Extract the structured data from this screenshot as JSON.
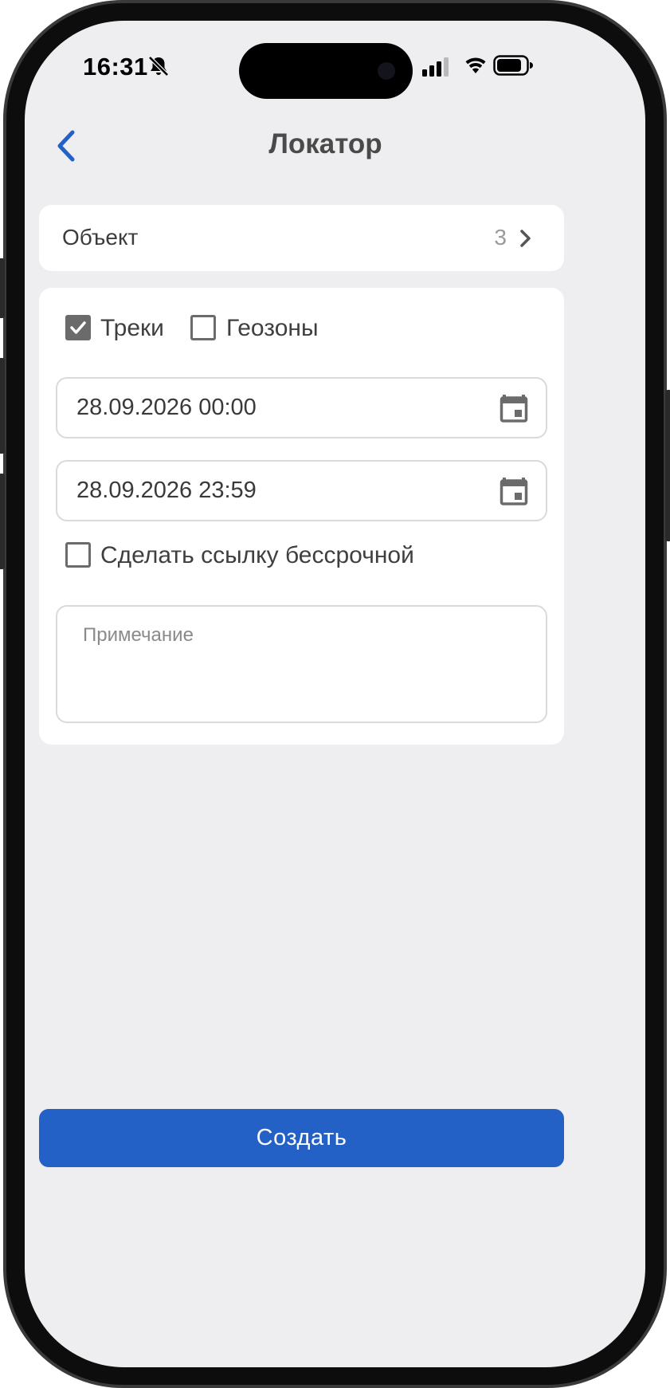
{
  "status_bar": {
    "time": "16:31",
    "silent_icon": "bell-slash-icon",
    "signal_icon": "cellular-signal-icon",
    "wifi_icon": "wifi-icon",
    "battery_icon": "battery-icon"
  },
  "nav": {
    "title": "Локатор",
    "back_icon": "chevron-left-icon"
  },
  "object_row": {
    "label": "Объект",
    "count": "3",
    "chevron_icon": "chevron-right-icon"
  },
  "filters": {
    "tracks": {
      "label": "Треки",
      "checked": true
    },
    "geozones": {
      "label": "Геозоны",
      "checked": false
    }
  },
  "date_from": {
    "value": "28.09.2026 00:00",
    "icon": "calendar-icon"
  },
  "date_to": {
    "value": "28.09.2026 23:59",
    "icon": "calendar-icon"
  },
  "permanent_link": {
    "label": "Сделать ссылку бессрочной",
    "checked": false
  },
  "note": {
    "placeholder": "Примечание",
    "value": ""
  },
  "create_button": {
    "label": "Создать"
  },
  "colors": {
    "accent": "#2461c7",
    "background": "#eeeef0",
    "card": "#ffffff",
    "checkbox": "#6b6b6b"
  }
}
